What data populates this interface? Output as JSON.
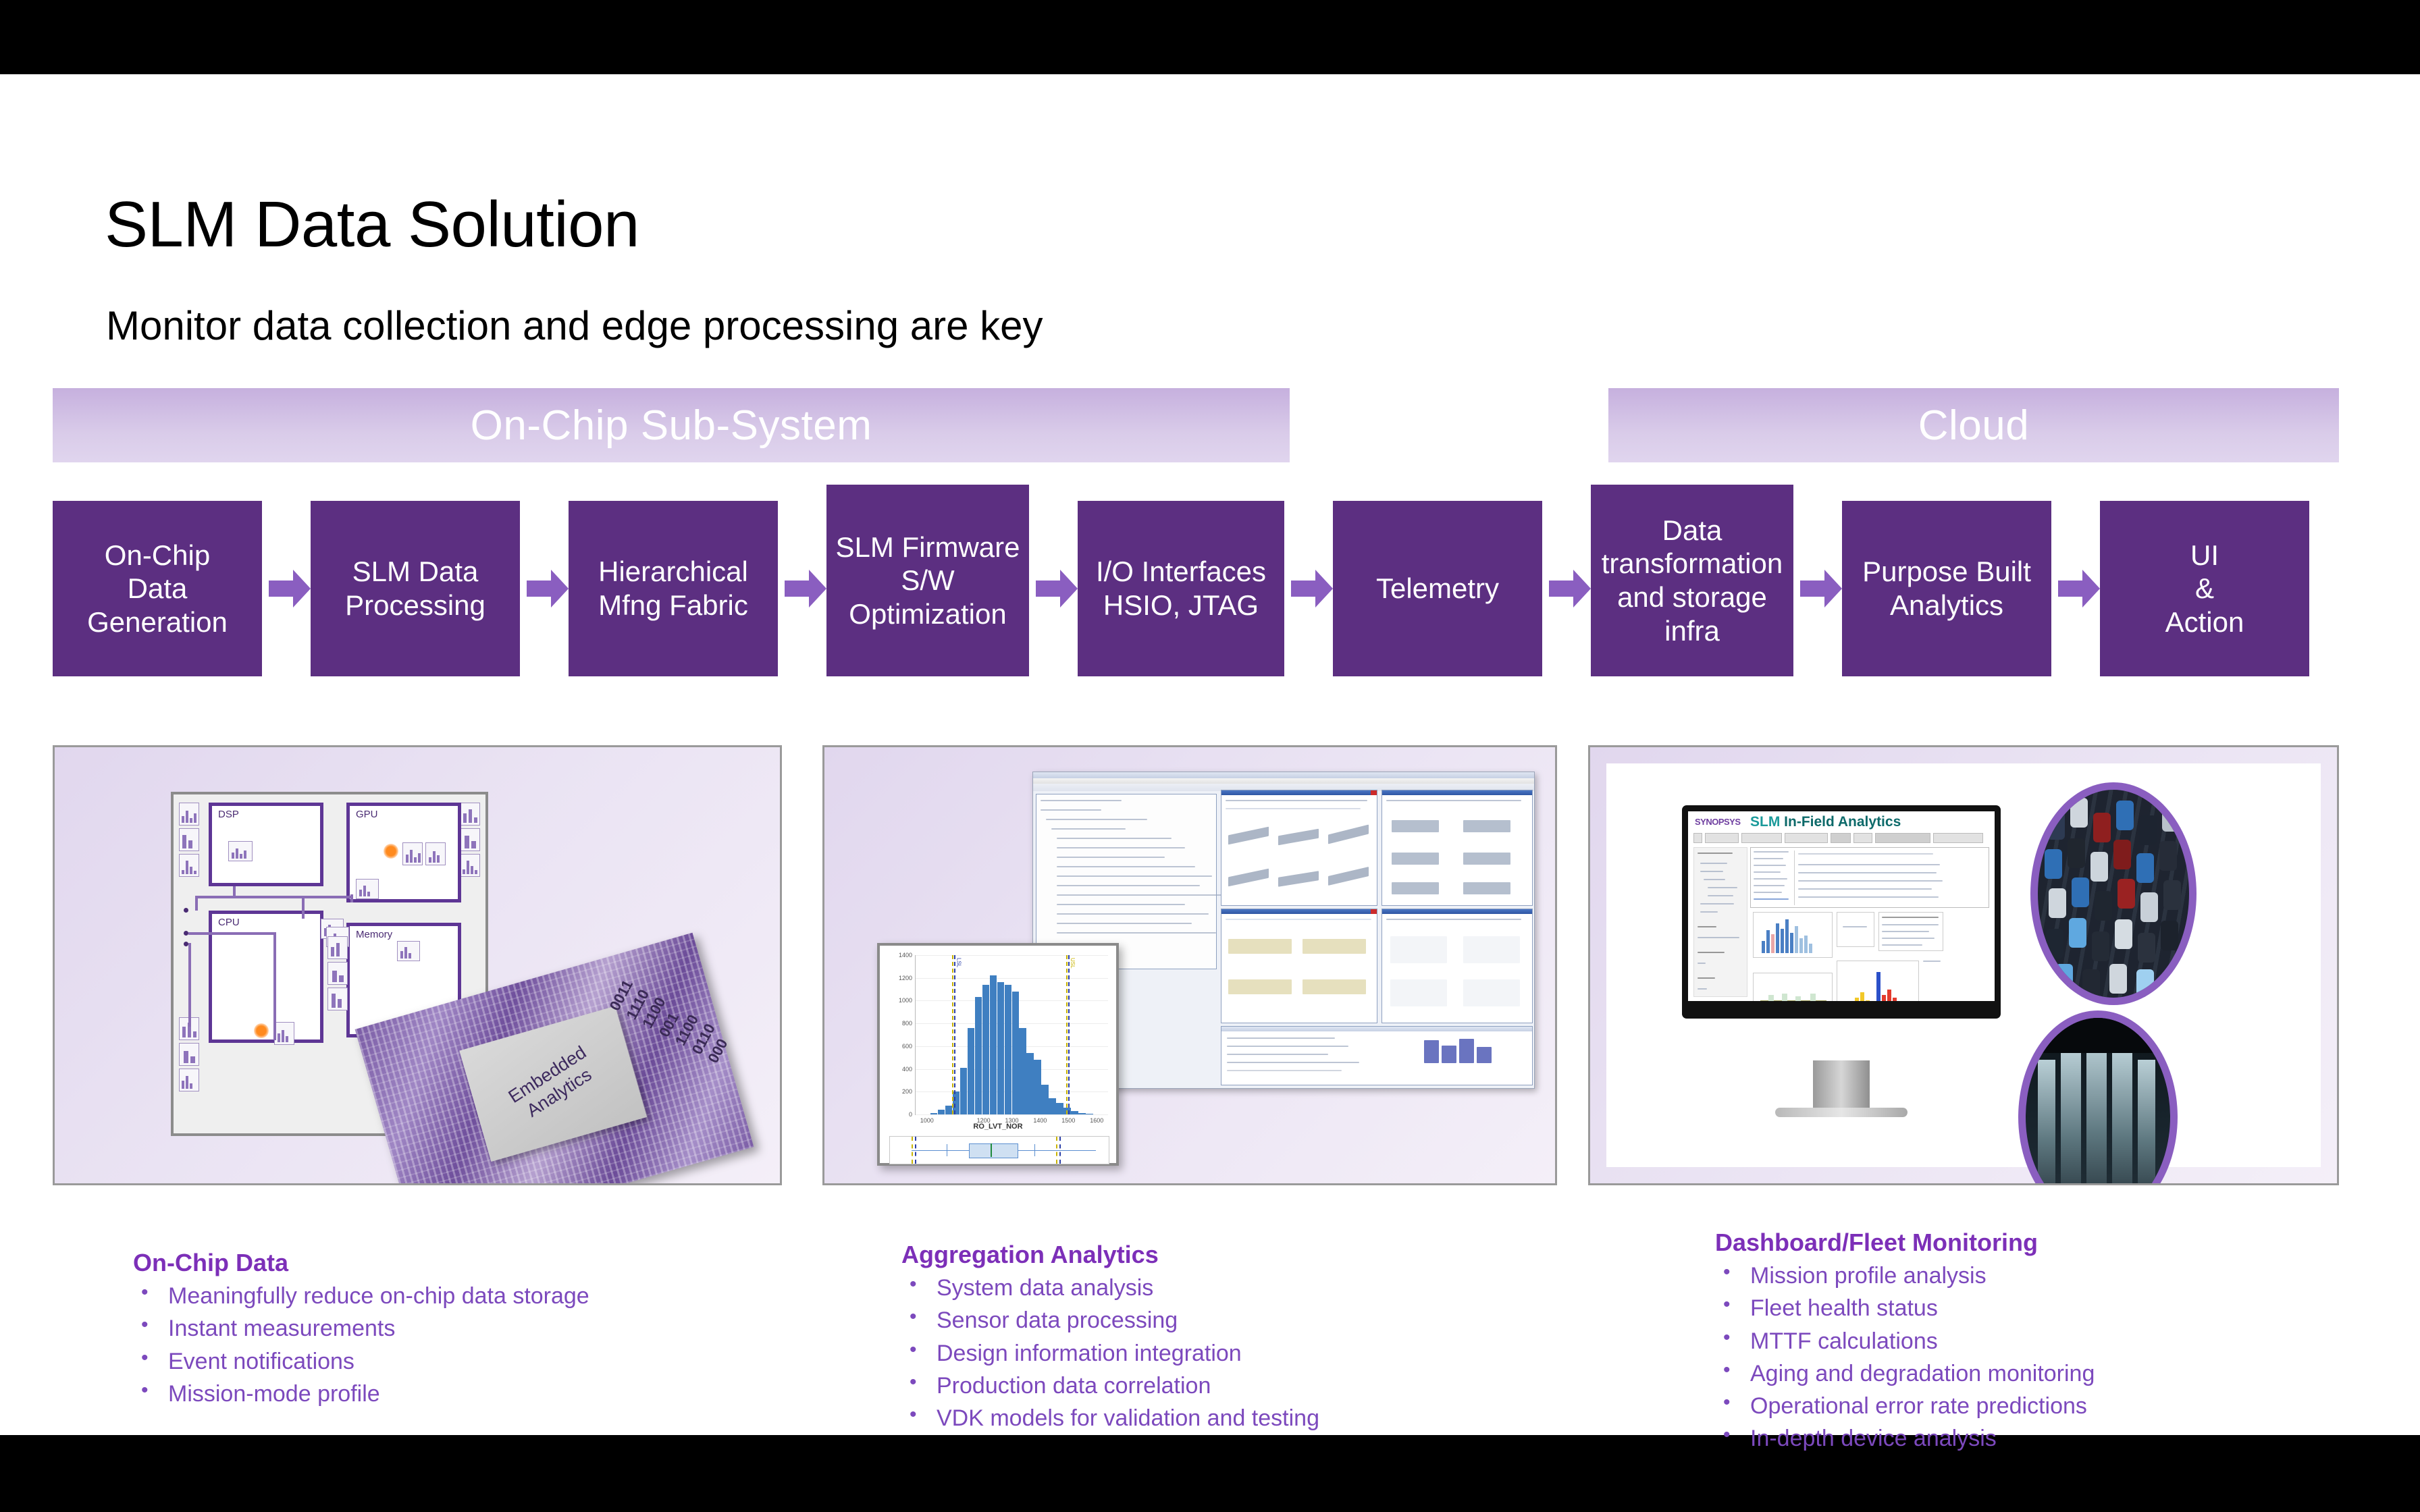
{
  "slide": {
    "title": "SLM Data Solution",
    "subtitle": "Monitor data collection and edge processing are key"
  },
  "banners": [
    {
      "label": "On-Chip Sub-System"
    },
    {
      "label": "Cloud"
    }
  ],
  "flow": {
    "onchip": [
      {
        "label": "On-Chip\nData\nGeneration"
      },
      {
        "label": "SLM Data\nProcessing"
      },
      {
        "label": "Hierarchical\nMfng Fabric"
      },
      {
        "label": "SLM Firmware\nS/W\nOptimization"
      },
      {
        "label": "I/O Interfaces\nHSIO, JTAG"
      },
      {
        "label": "Telemetry"
      }
    ],
    "cloud": [
      {
        "label": "Data\ntransformation\nand storage\ninfra"
      },
      {
        "label": "Purpose Built\nAnalytics"
      },
      {
        "label": "UI\n&\nAction"
      }
    ]
  },
  "panel1": {
    "blocks": [
      "DSP",
      "GPU",
      "CPU",
      "Memory"
    ],
    "die_label": "Embedded\nAnalytics",
    "bit_strings": [
      "0011",
      "1110",
      "1100",
      "001",
      "1100",
      "0110",
      "000"
    ]
  },
  "panel2": {
    "hist_xlabel": "RO_LVT_NOR"
  },
  "panel3": {
    "logo": "SYNOPSYS",
    "title_prefix": "SLM",
    "title_rest": " In-Field Analytics"
  },
  "bullets": [
    {
      "heading": "On-Chip Data",
      "items": [
        "Meaningfully reduce on-chip data storage",
        "Instant measurements",
        "Event notifications",
        "Mission-mode profile"
      ]
    },
    {
      "heading": "Aggregation Analytics",
      "items": [
        "System data analysis",
        "Sensor data processing",
        "Design information integration",
        "Production data correlation",
        "VDK models for validation and testing"
      ]
    },
    {
      "heading": "Dashboard/Fleet Monitoring",
      "items": [
        "Mission profile analysis",
        "Fleet health status",
        "MTTF calculations",
        "Aging and degradation monitoring",
        "Operational error rate predictions",
        "In-depth device analysis"
      ]
    }
  ],
  "chart_data": {
    "type": "bar",
    "title": "",
    "xlabel": "RO_LVT_NOR",
    "ylabel": "",
    "categories": [
      "1080",
      "1100",
      "1120",
      "1140",
      "1160",
      "1180",
      "1200",
      "1220",
      "1240",
      "1260",
      "1280",
      "1300",
      "1320",
      "1340",
      "1360",
      "1380",
      "1400",
      "1420",
      "1440",
      "1460",
      "1480",
      "1500"
    ],
    "values": [
      10,
      40,
      80,
      200,
      410,
      760,
      1030,
      1140,
      1225,
      1165,
      1140,
      1080,
      760,
      540,
      480,
      260,
      140,
      100,
      60,
      30,
      10,
      5
    ],
    "ylim": [
      0,
      1400
    ],
    "yticks": [
      0,
      200,
      400,
      600,
      800,
      1000,
      1200,
      1400
    ],
    "xticks": [
      1000,
      1200,
      1300,
      1400,
      1500,
      1600
    ],
    "grid": true,
    "annotations": [
      "LSL",
      "USL"
    ]
  },
  "colors": {
    "box_purple": "#5c2f81",
    "arrow_purple": "#8a5ec0",
    "banner_light": "#c6b0de",
    "bullet_purple": "#7c49bd",
    "heading_purple": "#7c2fb8",
    "bar_blue": "#3f7fc1",
    "accent_orange": "#ff8a1e"
  }
}
